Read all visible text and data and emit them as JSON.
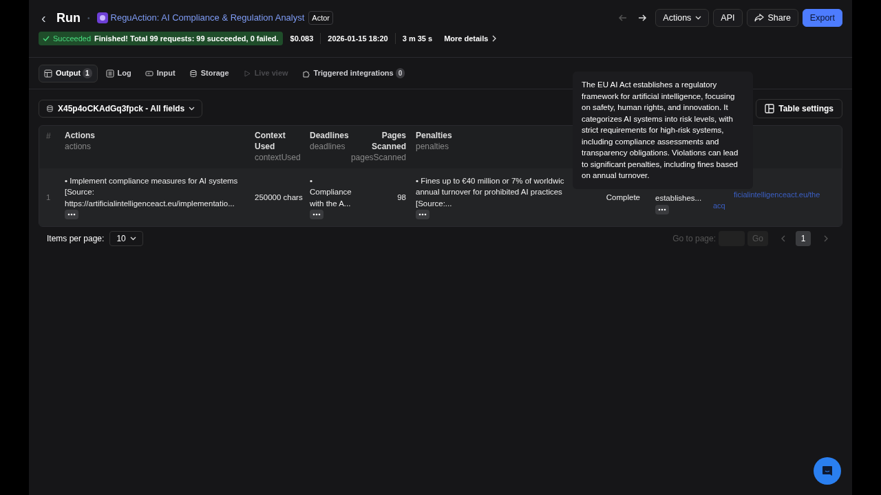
{
  "header": {
    "back": "‹",
    "title": "Run",
    "separator": "•",
    "actor_name": "ReguAction: AI Compliance & Regulation Analyst",
    "actor_badge": "Actor"
  },
  "toolbar": {
    "buttons": [
      {
        "label": "Actions",
        "kind": "dropdown"
      },
      {
        "label": "API",
        "kind": "plain"
      },
      {
        "label": "Share",
        "kind": "share"
      },
      {
        "label": "Export",
        "kind": "primary"
      }
    ]
  },
  "status": {
    "state": "Succeeded",
    "message": "Finished! Total 99 requests: 99 succeeded, 0 failed.",
    "cost": "$0.083",
    "started": "2026-01-15 18:20",
    "duration": "3 m 35 s",
    "more": "More details"
  },
  "tabs": [
    {
      "label": "Output",
      "count": "1",
      "selected": true,
      "disabled": false
    },
    {
      "label": "Log",
      "selected": false,
      "disabled": false
    },
    {
      "label": "Input",
      "selected": false,
      "disabled": false
    },
    {
      "label": "Storage",
      "selected": false,
      "disabled": false
    },
    {
      "label": "Live view",
      "selected": false,
      "disabled": true
    },
    {
      "label": "Triggered integrations",
      "count": "0",
      "selected": false,
      "disabled": false
    }
  ],
  "dataset": {
    "label": "X45p4oCKAdGq3fpck - All fields"
  },
  "table_settings": "Table settings",
  "table": {
    "columns": [
      {
        "label": "#"
      },
      {
        "label": "Actions",
        "field": "actions"
      },
      {
        "label": "Context Used",
        "field": "contextUsed"
      },
      {
        "label": "Deadlines",
        "field": "deadlines"
      },
      {
        "label": "Pages Scanned",
        "field": "pagesScanned"
      },
      {
        "label": "Penalties",
        "field": "penalties"
      }
    ],
    "rows": [
      {
        "cells": [
          {
            "text": "1",
            "kind": "index"
          },
          {
            "text": "• Implement compliance measures for AI systems [Source: https://artificialintelligenceact.eu/implementatio...",
            "kind": "text",
            "more": true
          },
          {
            "text": "250000 chars",
            "kind": "text"
          },
          {
            "text": "• Compliance with the A...",
            "kind": "text",
            "more": true
          },
          {
            "text": "98",
            "kind": "number"
          },
          {
            "lines": [
              "• Fines up to €40 million or 7% of worldwic",
              "annual turnover for prohibited AI practices",
              "[Source:..."
            ],
            "kind": "clipped",
            "more": true
          },
          {
            "text": "Complete",
            "kind": "center"
          },
          {
            "text": "establishes...",
            "kind": "text",
            "more": true
          },
          {
            "lines": [
              "ficialintelligenceact.eu/the",
              "acq"
            ],
            "kind": "link"
          }
        ]
      }
    ]
  },
  "pagination": {
    "items_label": "Items per page:",
    "per_page": "10",
    "goto_label": "Go to page:",
    "go": "Go",
    "pages": [
      {
        "label": "1",
        "selected": true
      }
    ]
  },
  "tooltip": "The EU AI Act establishes a regulatory framework for artificial intelligence, focusing on safety, human rights, and innovation. It categorizes AI systems into risk levels, with strict requirements for high-risk systems, including compliance assessments and transparency obligations. Violations can lead to significant penalties, including fines based on annual turnover."
}
